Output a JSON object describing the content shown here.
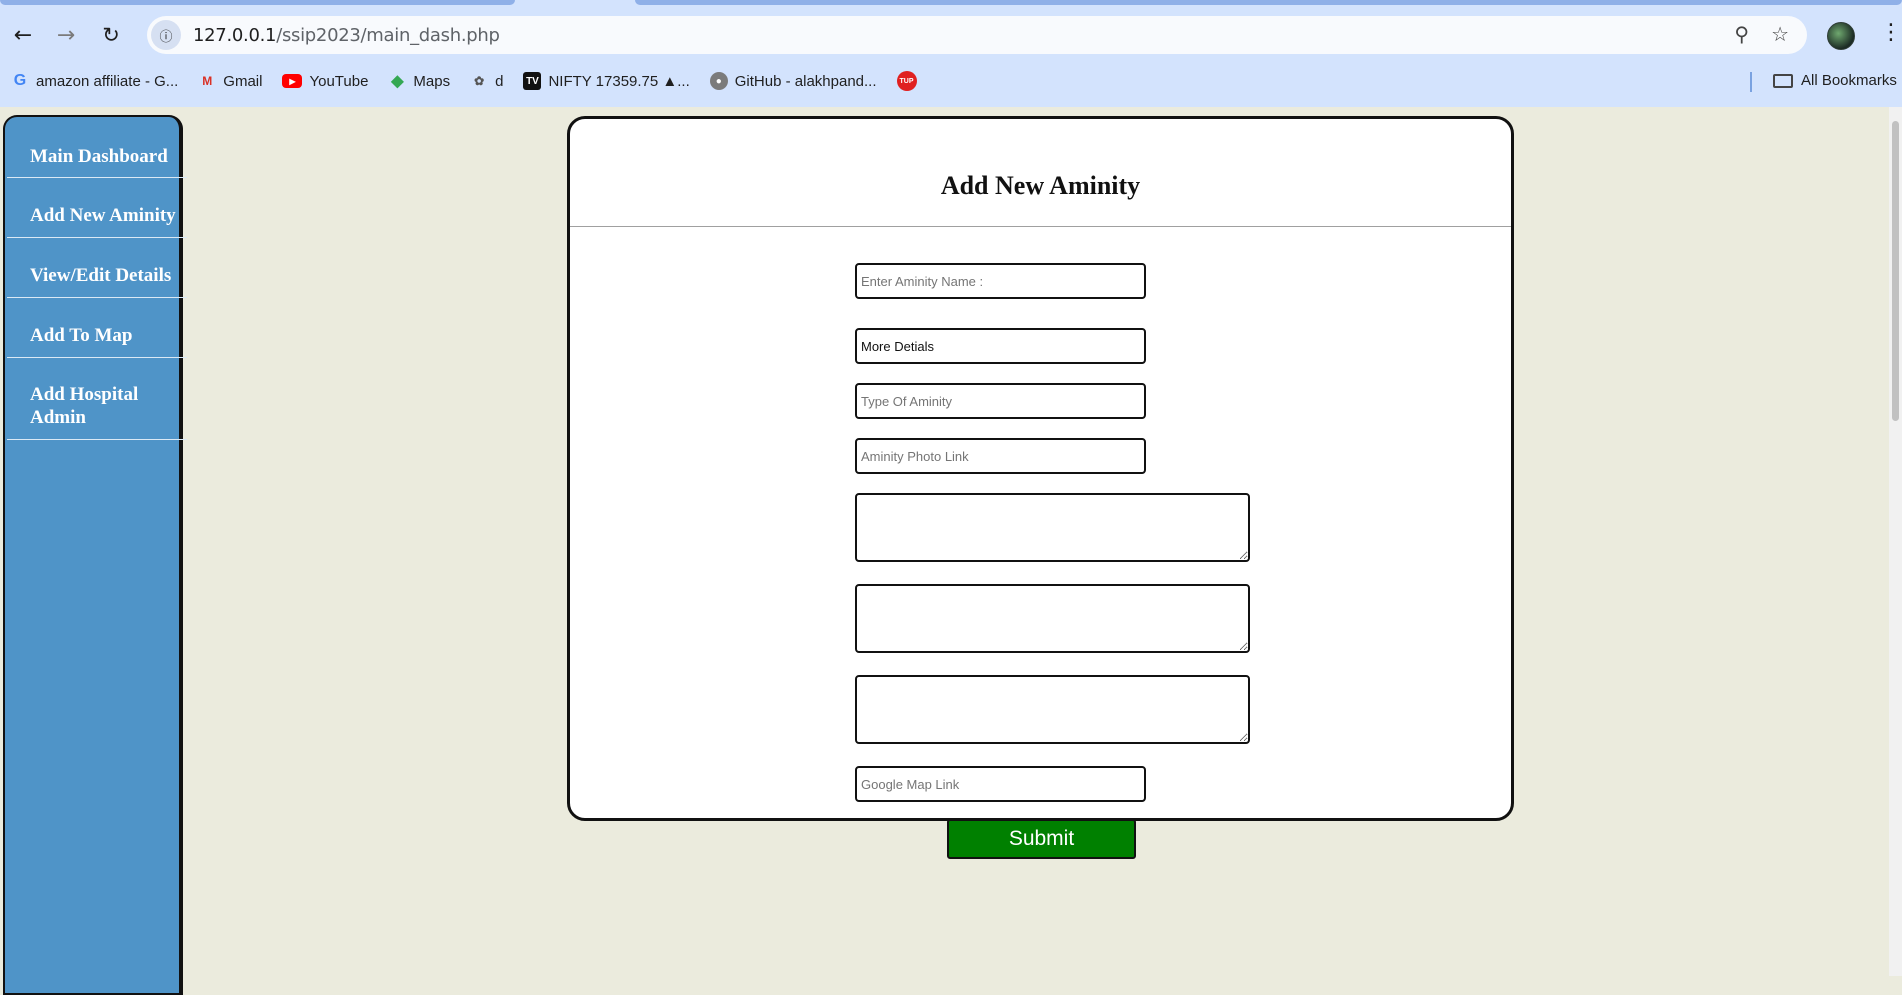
{
  "browser": {
    "url_host": "127.0.0.1",
    "url_path": "/ssip2023/main_dash.php",
    "bookmarks": [
      {
        "label": "amazon affiliate - G...",
        "icon": "google-icon"
      },
      {
        "label": "Gmail",
        "icon": "gmail-icon"
      },
      {
        "label": "YouTube",
        "icon": "youtube-icon"
      },
      {
        "label": "Maps",
        "icon": "maps-icon"
      },
      {
        "label": "d",
        "icon": "d-favicon"
      },
      {
        "label": "NIFTY 17359.75 ▲...",
        "icon": "tradingview-icon"
      },
      {
        "label": "GitHub - alakhpand...",
        "icon": "github-icon"
      },
      {
        "label": "",
        "icon": "tup-icon"
      }
    ],
    "all_bookmarks": "All Bookmarks"
  },
  "sidebar": {
    "items": [
      {
        "label": "Main Dashboard"
      },
      {
        "label": "Add New Aminity"
      },
      {
        "label": "View/Edit Details"
      },
      {
        "label": "Add To Map"
      },
      {
        "label": "Add Hospital Admin"
      }
    ]
  },
  "form": {
    "title": "Add New Aminity",
    "name_placeholder": "Enter Aminity Name :",
    "details_value": "More Detials",
    "type_placeholder": "Type Of Aminity",
    "photo_placeholder": "Aminity Photo Link",
    "map_placeholder": "Google Map Link",
    "submit_label": "Submit"
  },
  "colors": {
    "sidebar": "#4f94c8",
    "page_background": "#ebebdd",
    "submit_button": "#008000"
  }
}
